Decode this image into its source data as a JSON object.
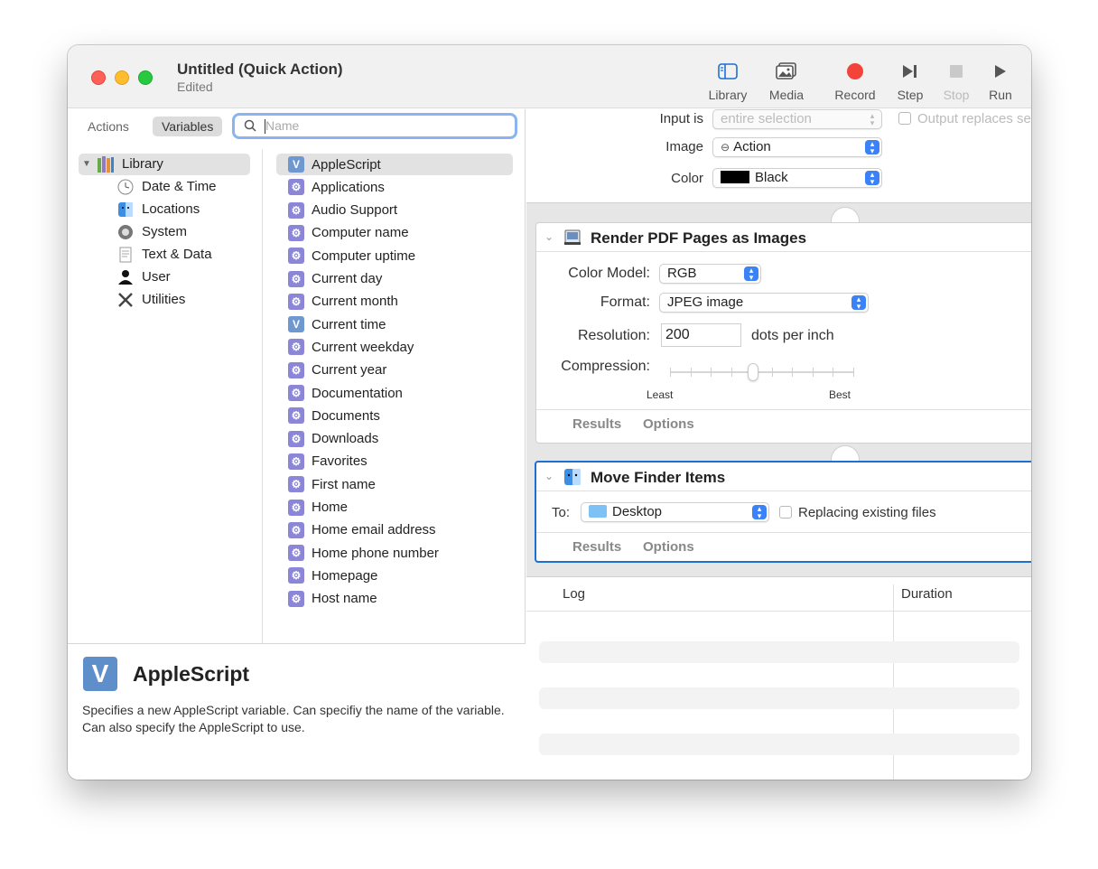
{
  "window": {
    "title": "Untitled (Quick Action)",
    "subtitle": "Edited"
  },
  "toolbar": {
    "library": "Library",
    "media": "Media",
    "record": "Record",
    "step": "Step",
    "stop": "Stop",
    "run": "Run"
  },
  "left": {
    "tabs": {
      "actions": "Actions",
      "variables": "Variables"
    },
    "search_placeholder": "Name",
    "categories": [
      {
        "label": "Library",
        "icon": "library-icon"
      },
      {
        "label": "Date & Time",
        "icon": "clock-icon"
      },
      {
        "label": "Locations",
        "icon": "finder-icon"
      },
      {
        "label": "System",
        "icon": "gear-icon"
      },
      {
        "label": "Text & Data",
        "icon": "text-icon"
      },
      {
        "label": "User",
        "icon": "user-icon"
      },
      {
        "label": "Utilities",
        "icon": "tools-icon"
      }
    ],
    "variables": [
      {
        "label": "AppleScript",
        "icon": "v-icon"
      },
      {
        "label": "Applications",
        "icon": "gear-icon"
      },
      {
        "label": "Audio Support",
        "icon": "gear-icon"
      },
      {
        "label": "Computer name",
        "icon": "gear-icon"
      },
      {
        "label": "Computer uptime",
        "icon": "gear-icon"
      },
      {
        "label": "Current day",
        "icon": "gear-icon"
      },
      {
        "label": "Current month",
        "icon": "gear-icon"
      },
      {
        "label": "Current time",
        "icon": "v-icon"
      },
      {
        "label": "Current weekday",
        "icon": "gear-icon"
      },
      {
        "label": "Current year",
        "icon": "gear-icon"
      },
      {
        "label": "Documentation",
        "icon": "gear-icon"
      },
      {
        "label": "Documents",
        "icon": "gear-icon"
      },
      {
        "label": "Downloads",
        "icon": "gear-icon"
      },
      {
        "label": "Favorites",
        "icon": "gear-icon"
      },
      {
        "label": "First name",
        "icon": "gear-icon"
      },
      {
        "label": "Home",
        "icon": "gear-icon"
      },
      {
        "label": "Home email address",
        "icon": "gear-icon"
      },
      {
        "label": "Home phone number",
        "icon": "gear-icon"
      },
      {
        "label": "Homepage",
        "icon": "gear-icon"
      },
      {
        "label": "Host name",
        "icon": "gear-icon"
      }
    ],
    "description": {
      "title": "AppleScript",
      "text": "Specifies a new AppleScript variable. Can specifiy the name of the variable. Can also specify the AppleScript to use."
    }
  },
  "workflow": {
    "input": {
      "input_label": "Input is",
      "input_value": "entire selection",
      "output_replaces": "Output replaces se",
      "image_label": "Image",
      "image_value": "Action",
      "color_label": "Color",
      "color_value": "Black",
      "color_swatch": "#000000"
    },
    "render_pdf": {
      "title": "Render PDF Pages as Images",
      "color_model_label": "Color Model:",
      "color_model_value": "RGB",
      "format_label": "Format:",
      "format_value": "JPEG image",
      "resolution_label": "Resolution:",
      "resolution_value": "200",
      "resolution_unit": "dots per inch",
      "compression_label": "Compression:",
      "compression_min": "Least",
      "compression_max": "Best",
      "compression_level": 0.45,
      "results": "Results",
      "options": "Options"
    },
    "move_finder": {
      "title": "Move Finder Items",
      "to_label": "To:",
      "to_value": "Desktop",
      "replacing_label": "Replacing existing files",
      "results": "Results",
      "options": "Options"
    }
  },
  "log": {
    "col_log": "Log",
    "col_duration": "Duration"
  },
  "colors": {
    "accent": "#1f6fd1",
    "record": "#f2443b",
    "variable_gear": "#8b86d8"
  }
}
